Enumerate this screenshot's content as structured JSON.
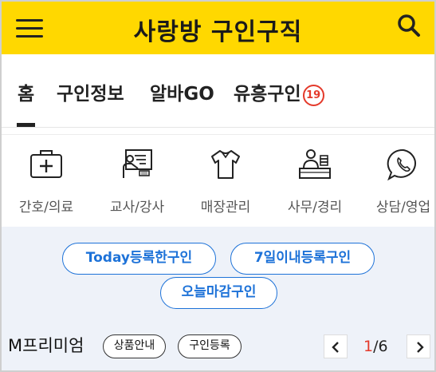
{
  "header": {
    "title": "사랑방 구인구직",
    "menu_icon": "hamburger-menu-icon",
    "search_icon": "search-icon",
    "background": "#ffd800"
  },
  "tabs": {
    "items": [
      {
        "label": "홈",
        "active": true
      },
      {
        "label": "구인정보"
      },
      {
        "label": "알바GO"
      },
      {
        "label": "유흥구인",
        "badge": "19"
      }
    ]
  },
  "categories": [
    {
      "label": "간호/의료",
      "icon": "medical-kit-icon"
    },
    {
      "label": "교사/강사",
      "icon": "teacher-board-icon"
    },
    {
      "label": "매장관리",
      "icon": "shirt-icon"
    },
    {
      "label": "사무/경리",
      "icon": "office-desk-icon"
    },
    {
      "label": "상담/영업",
      "icon": "phone-chat-icon"
    }
  ],
  "filters": {
    "today": {
      "prefix": "Today",
      "suffix": "등록한구인"
    },
    "week": "7일이내등록구인",
    "closing": "오늘마감구인"
  },
  "premium": {
    "title": "M프리미엄",
    "product_info": "상품안내",
    "register": "구인등록",
    "page_current": "1",
    "page_total": "/6"
  },
  "colors": {
    "accent_blue": "#1d72d8",
    "badge_red": "#e43a2b",
    "filter_bg": "#eef2f9"
  }
}
